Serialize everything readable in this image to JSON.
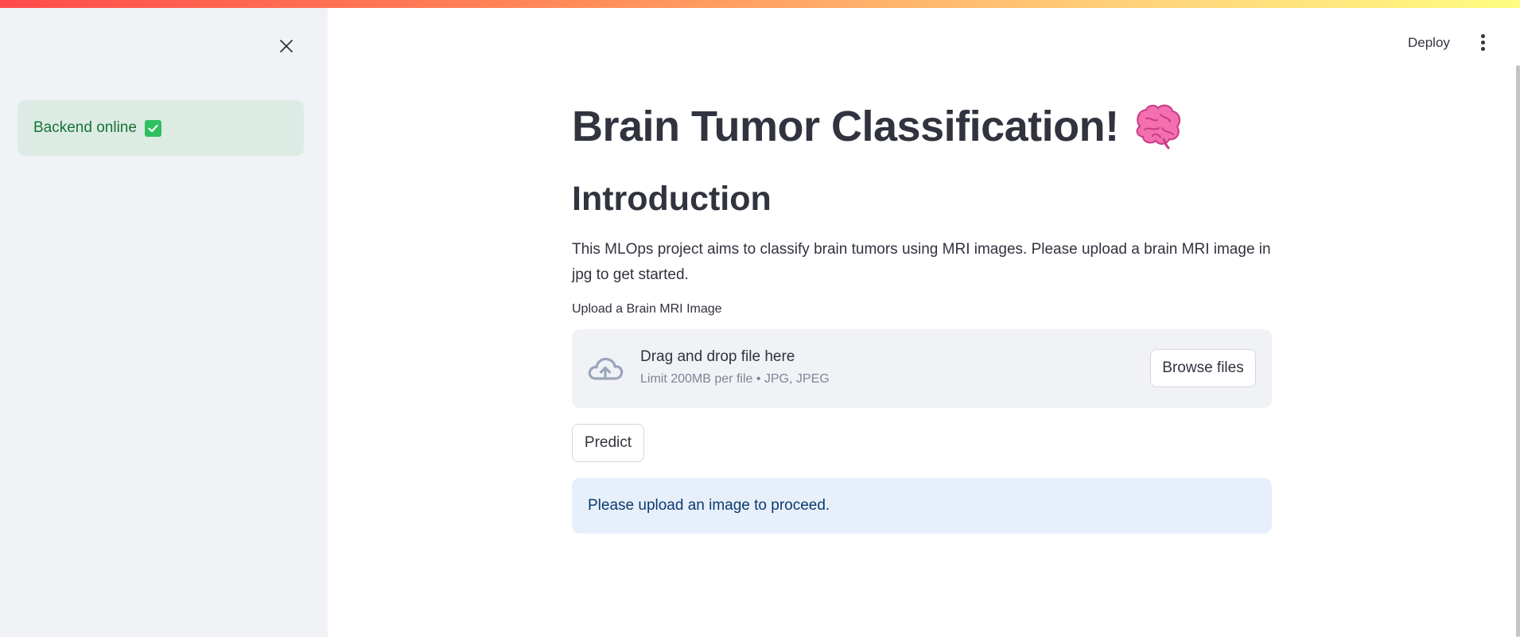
{
  "sidebar": {
    "close_icon": "close-icon",
    "status_text": "Backend online",
    "status_icon": "check-box-icon",
    "status_color": "#177233"
  },
  "header": {
    "deploy_label": "Deploy",
    "menu_icon": "vertical-dots-icon"
  },
  "main": {
    "title": "Brain Tumor Classification!",
    "title_icon": "brain-icon",
    "subheading": "Introduction",
    "intro_text": "This MLOps project aims to classify brain tumors using MRI images. Please upload a brain MRI image in jpg to get started.",
    "upload": {
      "label": "Upload a Brain MRI Image",
      "drop_text": "Drag and drop file here",
      "limit_text": "Limit 200MB per file • JPG, JPEG",
      "browse_label": "Browse files",
      "icon": "cloud-upload-icon"
    },
    "predict_label": "Predict",
    "info_text": "Please upload an image to proceed."
  },
  "colors": {
    "accent": "#ff4b4b",
    "sidebar_bg": "#f0f2f6",
    "success_bg": "#dcebe4",
    "info_bg": "#e7f0fa"
  }
}
